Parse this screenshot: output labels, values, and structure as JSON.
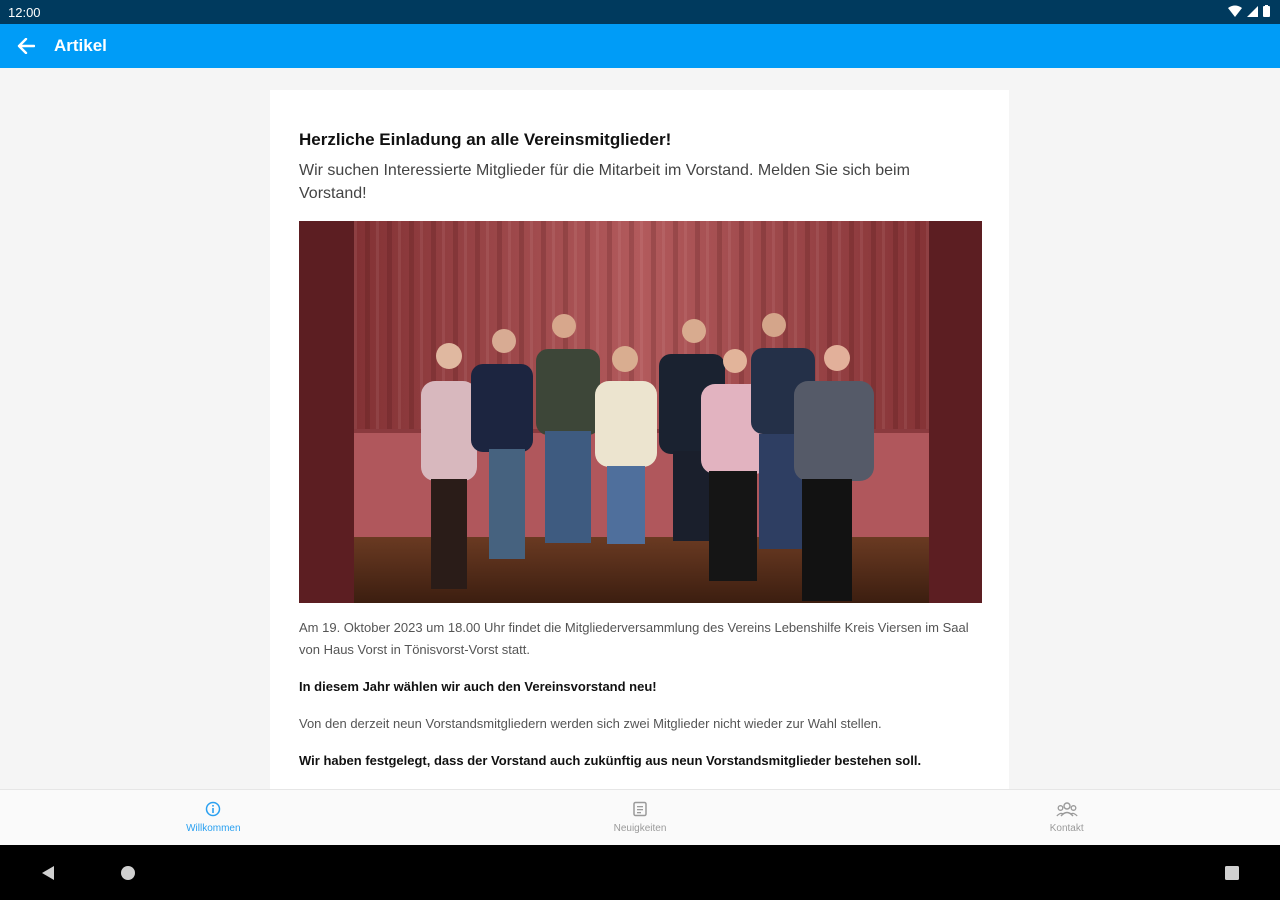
{
  "status_bar": {
    "time": "12:00"
  },
  "app_bar": {
    "title": "Artikel"
  },
  "article": {
    "headline": "Herzliche Einladung an alle Vereinsmitglieder!",
    "lead": "Wir suchen Interessierte Mitglieder für die Mitarbeit im Vorstand. Melden Sie sich beim Vorstand!",
    "paragraphs": [
      "Am 19. Oktober 2023 um 18.00 Uhr findet die Mitgliederversammlung des Vereins Lebenshilfe Kreis Viersen im Saal von Haus Vorst in Tönisvorst-Vorst statt.",
      "In diesem Jahr wählen wir auch den Vereinsvorstand neu!",
      "Von den derzeit neun Vorstandsmitgliedern werden sich zwei Mitglieder nicht wieder zur Wahl stellen.",
      "Wir haben festgelegt, dass der Vorstand auch zukünftig aus neun Vorstandsmitglieder bestehen soll."
    ]
  },
  "bottom_nav": {
    "items": [
      {
        "label": "Willkommen",
        "icon": "info-icon",
        "active": true
      },
      {
        "label": "Neuigkeiten",
        "icon": "news-icon",
        "active": false
      },
      {
        "label": "Kontakt",
        "icon": "people-icon",
        "active": false
      }
    ]
  },
  "colors": {
    "app_bar": "#009cf7",
    "status_bar": "#003a5e",
    "active_nav": "#2aa0f0"
  }
}
